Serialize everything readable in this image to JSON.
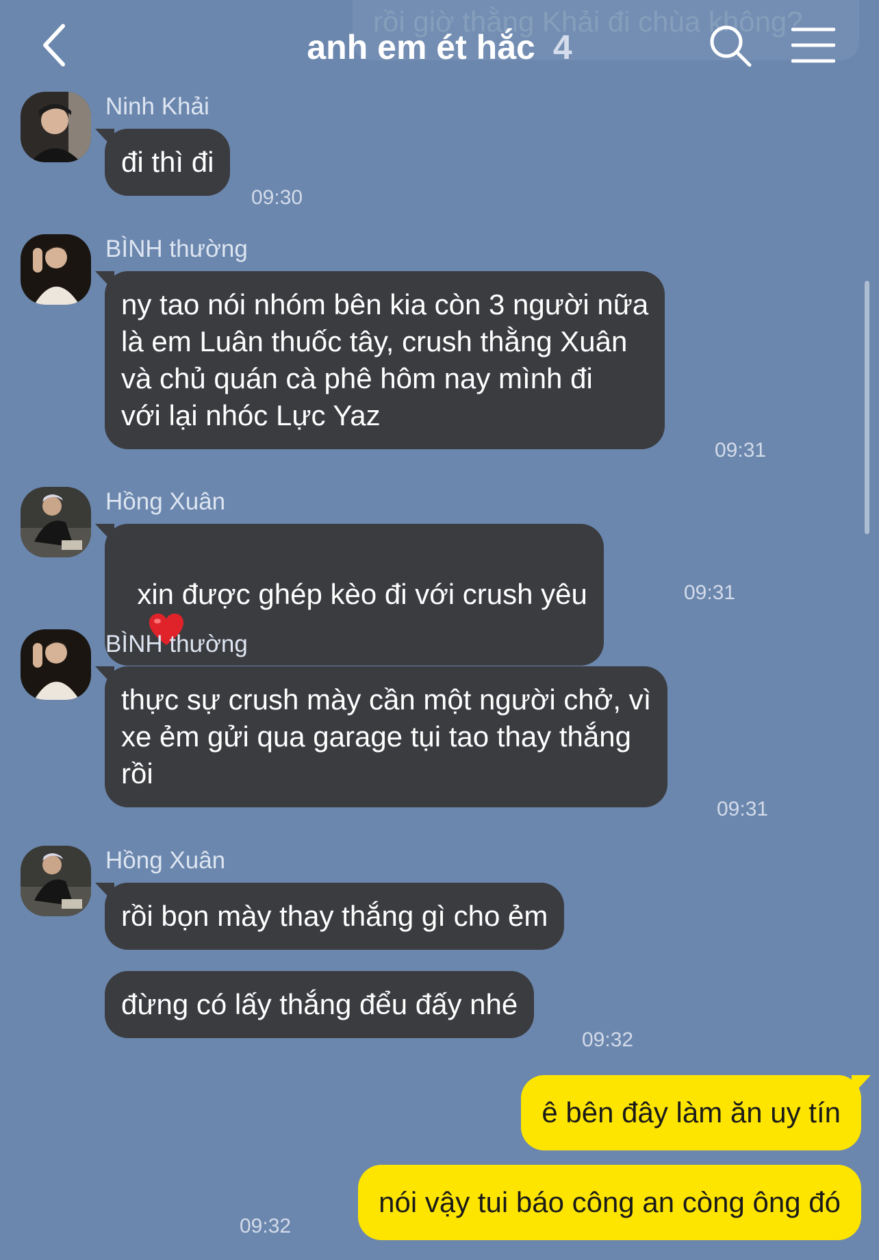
{
  "header": {
    "ghost_message": "rồi giờ thằng Khải đi chùa không?",
    "title": "anh em ét hắc",
    "member_count": "4",
    "icons": [
      "chevron-left-icon",
      "search-icon",
      "menu-icon"
    ]
  },
  "messages": [
    {
      "sender": "Ninh Khải",
      "bubbles": [
        "đi thì đi"
      ],
      "time": "09:30"
    },
    {
      "sender": "BÌNH thường",
      "bubbles": [
        "ny tao nói nhóm bên kia còn 3 người nữa\nlà em Luân thuốc tây, crush thằng Xuân\nvà chủ quán cà phê hôm nay mình đi\nvới lại nhóc Lực Yaz"
      ],
      "time": "09:31"
    },
    {
      "sender": "Hồng Xuân",
      "bubbles": [
        "xin được ghép kèo đi với crush yêu"
      ],
      "emoji": "❤️",
      "time": "09:31"
    },
    {
      "sender": "BÌNH thường",
      "bubbles": [
        "thực sự crush mày cần một người chở, vì\nxe ẻm gửi qua garage tụi tao thay thắng\nrồi"
      ],
      "time": "09:31"
    },
    {
      "sender": "Hồng Xuân",
      "bubbles": [
        "rồi bọn mày thay thắng gì cho ẻm",
        "đừng có lấy thắng đểu đấy nhé"
      ],
      "time": "09:32"
    }
  ],
  "my_messages": {
    "bubbles": [
      "ê bên đây làm ăn uy tín",
      "nói vậy tui báo công an còng ông đó"
    ],
    "time": "09:32"
  },
  "colors": {
    "background": "#6b87ae",
    "incoming_bubble": "#3b3c40",
    "outgoing_bubble": "#fee500",
    "heart": "#e0232b"
  }
}
